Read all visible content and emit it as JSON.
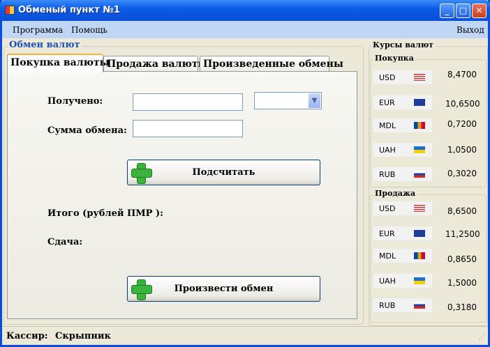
{
  "window": {
    "title": "Обменый пункт №1"
  },
  "menu": {
    "program": "Программа",
    "help": "Помощь",
    "exit": "Выход"
  },
  "exchange_group": {
    "title": "Обмен валют"
  },
  "tabs": [
    "Покупка валюты",
    "Продажа валюты",
    "Произведенные обмены"
  ],
  "form": {
    "received_label": "Получено:",
    "received_value": "",
    "currency_select_value": "",
    "sum_label": "Сумма обмена:",
    "sum_value": "",
    "calculate_button": "Подсчитать",
    "total_label": "Итого (рублей ПМР ):",
    "change_label": "Сдача:",
    "exchange_button": "Произвести обмен"
  },
  "rates": {
    "title": "Курсы валют",
    "buy": {
      "title": "Покупка",
      "items": [
        {
          "code": "USD",
          "flag": "us",
          "value": "8,4700"
        },
        {
          "code": "EUR",
          "flag": "eu",
          "value": "10,6500"
        },
        {
          "code": "MDL",
          "flag": "md",
          "value": "0,7200"
        },
        {
          "code": "UAH",
          "flag": "ua",
          "value": "1,0500"
        },
        {
          "code": "RUB",
          "flag": "ru",
          "value": "0,3020"
        }
      ]
    },
    "sell": {
      "title": "Продажа",
      "items": [
        {
          "code": "USD",
          "flag": "us",
          "value": "8,6500"
        },
        {
          "code": "EUR",
          "flag": "eu",
          "value": "11,2500"
        },
        {
          "code": "MDL",
          "flag": "md",
          "value": "0,8650"
        },
        {
          "code": "UAH",
          "flag": "ua",
          "value": "1,5000"
        },
        {
          "code": "RUB",
          "flag": "ru",
          "value": "0,3180"
        }
      ]
    }
  },
  "status": {
    "cashier_label": "Кассир:",
    "cashier_name": "Скрыпник"
  }
}
